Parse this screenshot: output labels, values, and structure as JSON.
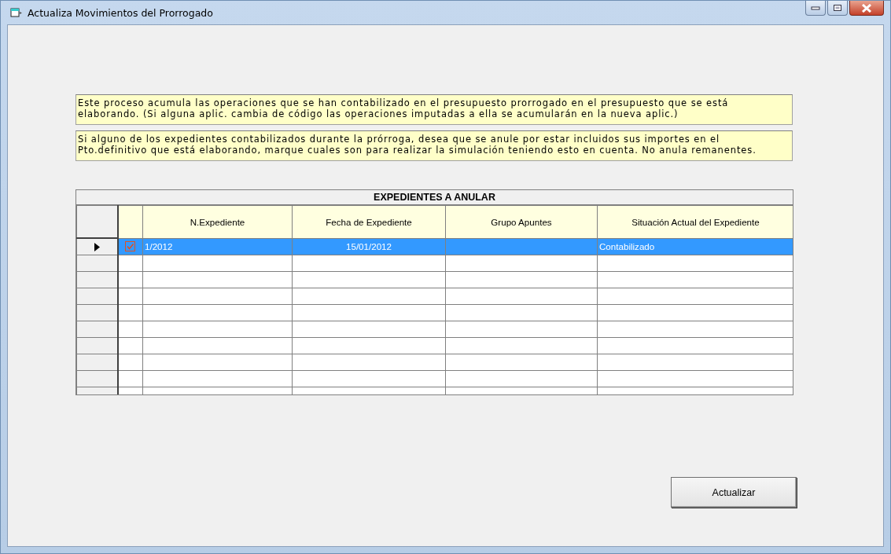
{
  "window": {
    "title": "Actualiza Movimientos del Prorrogado"
  },
  "notes": [
    "Este proceso acumula las operaciones que se han contabilizado en el presupuesto prorrogado en el presupuesto que se está elaborando. (Si alguna aplic. cambia de código las operaciones imputadas a ella se acumularán en la nueva aplic.)",
    "Si alguno de los expedientes contabilizados durante la prórroga, desea que se anule por estar incluidos sus importes en el Pto.definitivo que está elaborando, marque cuales son para realizar la simulación teniendo esto en cuenta. No anula remanentes."
  ],
  "table": {
    "title": "EXPEDIENTES A ANULAR",
    "columns": [
      "N.Expediente",
      "Fecha de Expediente",
      "Grupo Apuntes",
      "Situación Actual del Expediente"
    ],
    "rows": [
      {
        "current": true,
        "selected": true,
        "checked": true,
        "cells": [
          "1/2012",
          "15/01/2012",
          "",
          "Contabilizado"
        ]
      }
    ]
  },
  "buttons": [
    {
      "label": "Actualizar"
    }
  ]
}
